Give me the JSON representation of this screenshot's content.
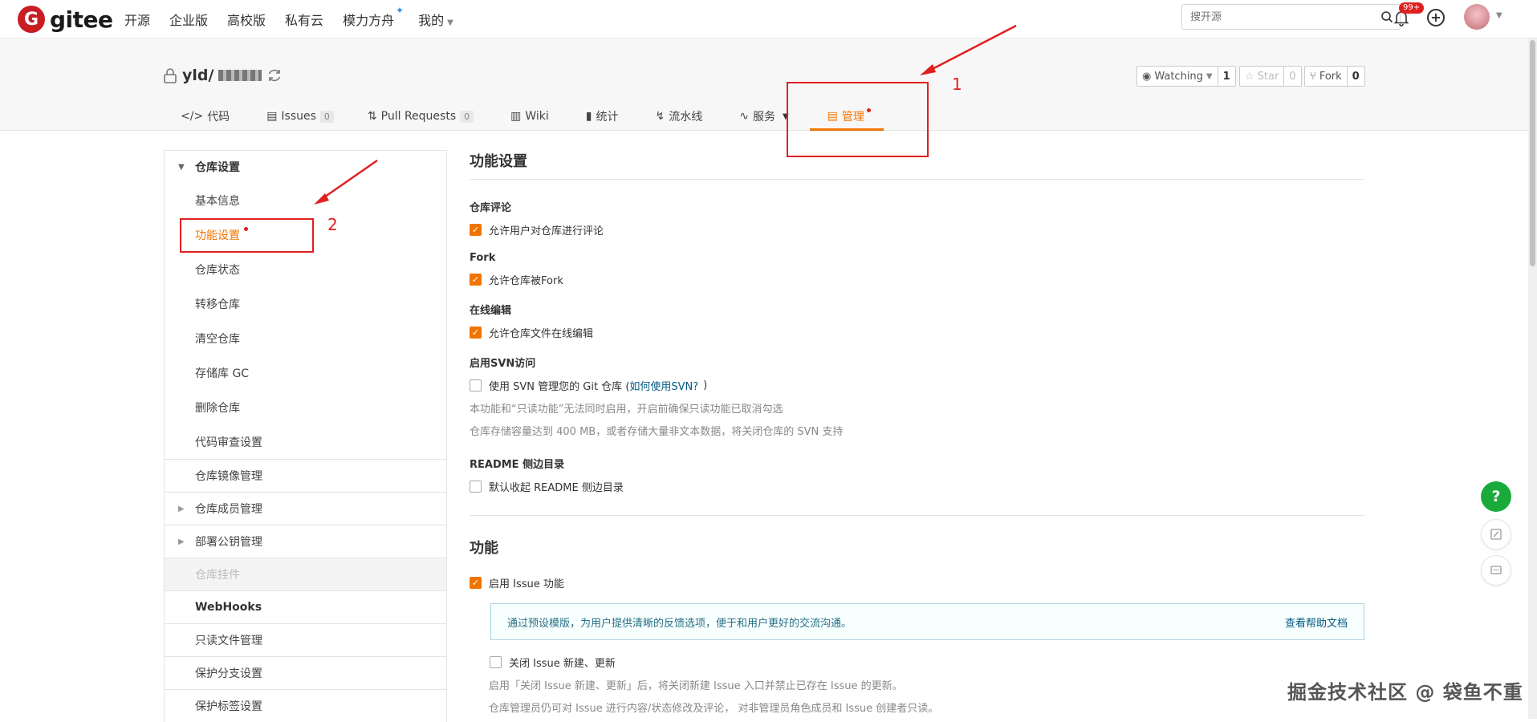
{
  "topnav": {
    "logo_mark": "G",
    "logo_text": "gitee",
    "links": [
      "开源",
      "企业版",
      "高校版",
      "私有云",
      "模力方舟",
      "我的"
    ],
    "search_placeholder": "搜开源",
    "notif_badge": "99+"
  },
  "repo": {
    "owner_prefix": "yld/",
    "actions": {
      "watch_label": "Watching",
      "watch_count": "1",
      "star_label": "Star",
      "star_count": "0",
      "fork_label": "Fork",
      "fork_count": "0"
    },
    "tabs": [
      {
        "label": "代码",
        "icon": "code-icon"
      },
      {
        "label": "Issues",
        "count": "0",
        "icon": "issues-icon"
      },
      {
        "label": "Pull Requests",
        "count": "0",
        "icon": "pr-icon"
      },
      {
        "label": "Wiki",
        "icon": "wiki-icon"
      },
      {
        "label": "统计",
        "icon": "stats-icon"
      },
      {
        "label": "流水线",
        "icon": "pipeline-icon"
      },
      {
        "label": "服务",
        "icon": "service-icon"
      },
      {
        "label": "管理",
        "icon": "manage-icon"
      }
    ]
  },
  "sidebar": {
    "group_title": "仓库设置",
    "items": [
      "基本信息",
      "功能设置",
      "仓库状态",
      "转移仓库",
      "清空仓库",
      "存储库 GC",
      "删除仓库",
      "代码审查设置"
    ],
    "sections": [
      "仓库镜像管理",
      "仓库成员管理",
      "部署公钥管理",
      "仓库挂件",
      "WebHooks",
      "只读文件管理",
      "保护分支设置",
      "保护标签设置"
    ]
  },
  "content": {
    "title": "功能设置",
    "comment_label": "仓库评论",
    "comment_check": "允许用户对仓库进行评论",
    "fork_label": "Fork",
    "fork_check": "允许仓库被Fork",
    "online_label": "在线编辑",
    "online_check": "允许仓库文件在线编辑",
    "svn_label": "启用SVN访问",
    "svn_check_pre": "使用 SVN 管理您的 Git 仓库 (",
    "svn_link": "如何使用SVN?",
    "svn_check_post": ")",
    "svn_hint1": "本功能和“只读功能”无法同时启用，开启前确保只读功能已取消勾选",
    "svn_hint2": "仓库存储容量达到 400 MB，或者存储大量非文本数据，将关闭仓库的 SVN 支持",
    "readme_label": "README 侧边目录",
    "readme_check": "默认收起 README 侧边目录",
    "feature_title": "功能",
    "issue_check": "启用 Issue 功能",
    "info_text": "通过预设模版，为用户提供清晰的反馈选项，便于和用户更好的交流沟通。",
    "info_link": "查看帮助文档",
    "close_issue_check": "关闭 Issue 新建、更新",
    "close_hint1": "启用「关闭 Issue 新建、更新」后，将关闭新建 Issue 入口并禁止已存在 Issue 的更新。",
    "close_hint2": "仓库管理员仍可对 Issue 进行内容/状态修改及评论， 对非管理员角色成员和 Issue 创建者只读。"
  },
  "annotations": {
    "num1": "1",
    "num2": "2"
  },
  "float": {
    "help": "?"
  },
  "watermark": "掘金技术社区 @ 袋鱼不重",
  "colors": {
    "accent": "#f07500",
    "brand": "#c71d23",
    "annotation": "#e02020"
  }
}
